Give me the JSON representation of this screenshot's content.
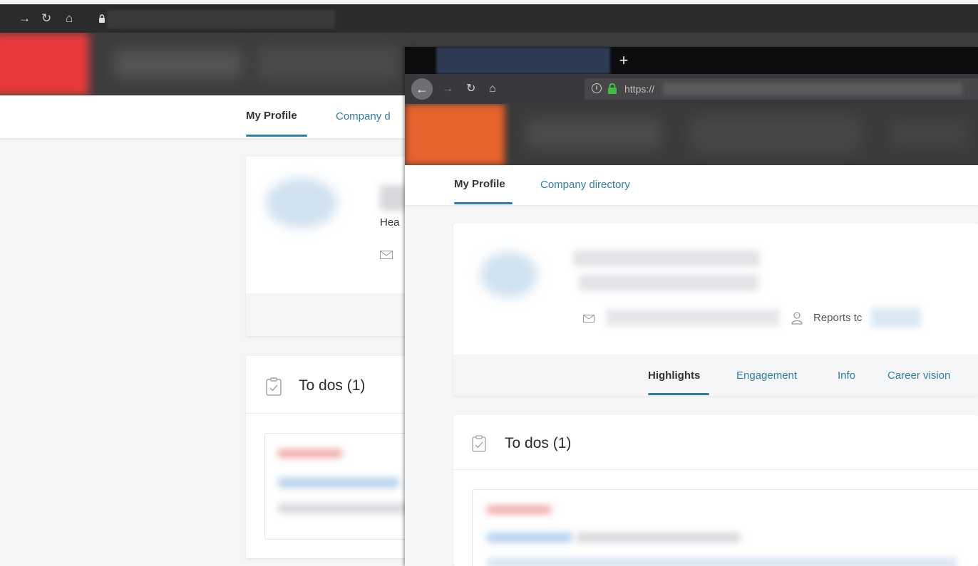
{
  "back_window": {
    "tabs": {
      "my_profile": "My Profile",
      "company_directory": "Company d"
    },
    "profile": {
      "title_fragment": "Hea"
    },
    "todos": {
      "title": "To dos",
      "count": "(1)"
    }
  },
  "front_window": {
    "new_tab_label": "+",
    "url": {
      "prefix": "https://"
    },
    "tabs": {
      "my_profile": "My Profile",
      "company_directory": "Company directory"
    },
    "profile": {
      "reports_to_label": "Reports tc"
    },
    "subtabs": [
      "Highlights",
      "Engagement",
      "Info",
      "Career vision"
    ],
    "todos": {
      "title": "To dos",
      "count": "(1)"
    }
  },
  "colors": {
    "accent": "#2e7fa5",
    "browser_dark": "#38383d",
    "lock_green": "#3fbf3f"
  },
  "icons": {
    "back": "arrow-left",
    "forward": "arrow-right",
    "reload": "reload",
    "home": "home",
    "lock": "lock",
    "mail": "envelope",
    "person": "person",
    "clipboard": "clipboard-check"
  }
}
